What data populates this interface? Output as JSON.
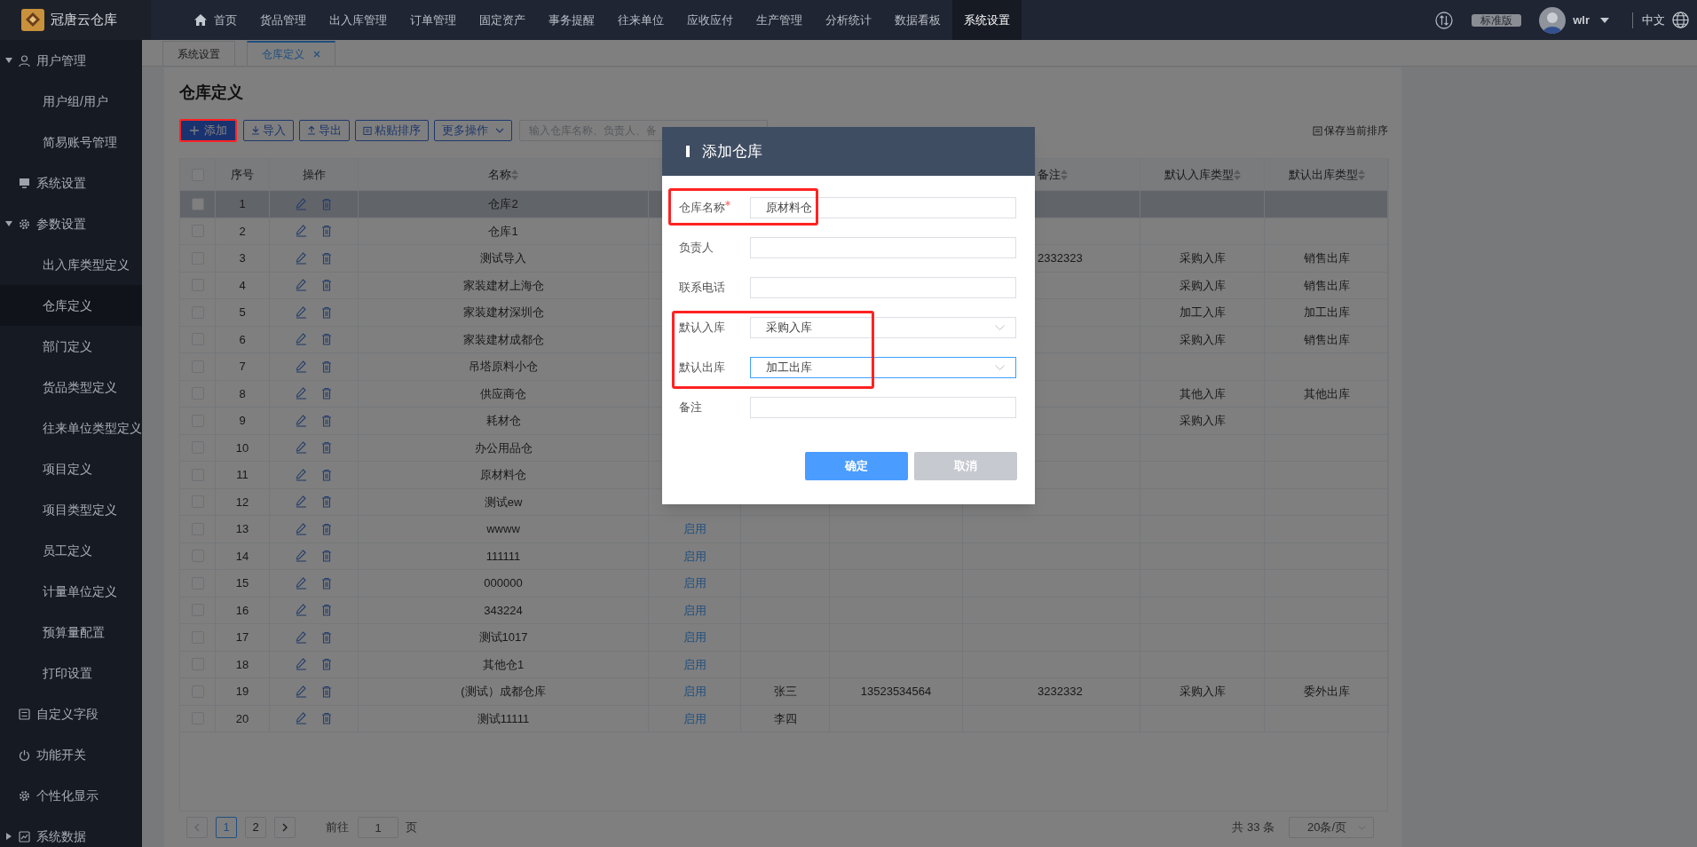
{
  "app": {
    "title": "冠唐云仓库"
  },
  "nav": {
    "items": [
      {
        "label": "首页",
        "selected": false
      },
      {
        "label": "货品管理",
        "selected": false
      },
      {
        "label": "出入库管理",
        "selected": false
      },
      {
        "label": "订单管理",
        "selected": false
      },
      {
        "label": "固定资产",
        "selected": false
      },
      {
        "label": "事务提醒",
        "selected": false
      },
      {
        "label": "往来单位",
        "selected": false
      },
      {
        "label": "应收应付",
        "selected": false
      },
      {
        "label": "生产管理",
        "selected": false
      },
      {
        "label": "分析统计",
        "selected": false
      },
      {
        "label": "数据看板",
        "selected": false
      },
      {
        "label": "系统设置",
        "selected": true
      }
    ]
  },
  "header_right": {
    "edition": "标准版",
    "user": "wlr",
    "language": "中文"
  },
  "sidebar": {
    "items": [
      {
        "label": "用户管理",
        "expanded": true,
        "children": [
          {
            "label": "用户组/用户",
            "selected": false
          },
          {
            "label": "简易账号管理",
            "selected": false
          }
        ]
      },
      {
        "label": "系统设置"
      },
      {
        "label": "参数设置",
        "expanded": true,
        "children": [
          {
            "label": "出入库类型定义",
            "selected": false
          },
          {
            "label": "仓库定义",
            "selected": true
          },
          {
            "label": "部门定义",
            "selected": false
          },
          {
            "label": "货品类型定义",
            "selected": false
          },
          {
            "label": "往来单位类型定义",
            "selected": false
          },
          {
            "label": "项目定义",
            "selected": false
          },
          {
            "label": "项目类型定义",
            "selected": false
          },
          {
            "label": "员工定义",
            "selected": false
          },
          {
            "label": "计量单位定义",
            "selected": false
          },
          {
            "label": "预算量配置",
            "selected": false
          },
          {
            "label": "打印设置",
            "selected": false
          }
        ]
      },
      {
        "label": "自定义字段"
      },
      {
        "label": "功能开关"
      },
      {
        "label": "个性化显示"
      },
      {
        "label": "系统数据",
        "expanded": false
      }
    ]
  },
  "tabs": [
    {
      "label": "系统设置",
      "selected": false,
      "closable": false
    },
    {
      "label": "仓库定义",
      "selected": true,
      "closable": true
    }
  ],
  "page": {
    "title": "仓库定义",
    "toolbar": [
      {
        "label": "添加",
        "kind": "add"
      },
      {
        "label": "导入",
        "kind": "import"
      },
      {
        "label": "导出",
        "kind": "export"
      },
      {
        "label": "粘贴排序",
        "kind": "paste"
      },
      {
        "label": "更多操作",
        "kind": "menu"
      }
    ],
    "search": {
      "placeholder": "输入仓库名称、负责人、备"
    },
    "save_sort": "保存当前排序"
  },
  "table": {
    "header": {
      "checked": false,
      "seq": {
        "text": "序号",
        "sortable": false
      },
      "actions": {
        "text": "操作",
        "sortable": false
      },
      "name": {
        "text": "名称",
        "sortable": true
      },
      "remark": {
        "text": "备注",
        "sortable": true
      },
      "in_type": {
        "text": "默认入库类型",
        "sortable": true
      },
      "out_type": {
        "text": "默认出库类型",
        "sortable": true
      }
    },
    "rows": [
      {
        "selected": true,
        "checked": false,
        "seq": "1",
        "name": "仓库2"
      },
      {
        "selected": false,
        "checked": false,
        "seq": "2",
        "name": "仓库1"
      },
      {
        "selected": false,
        "checked": false,
        "seq": "3",
        "name": "测试导入",
        "remark": "2332323",
        "in_type": "采购入库",
        "out_type": "销售出库"
      },
      {
        "selected": false,
        "checked": false,
        "seq": "4",
        "name": "家装建材上海仓",
        "in_type": "采购入库",
        "out_type": "销售出库"
      },
      {
        "selected": false,
        "checked": false,
        "seq": "5",
        "name": "家装建材深圳仓",
        "in_type": "加工入库",
        "out_type": "加工出库"
      },
      {
        "selected": false,
        "checked": false,
        "seq": "6",
        "name": "家装建材成都仓",
        "in_type": "采购入库",
        "out_type": "销售出库"
      },
      {
        "selected": false,
        "checked": false,
        "seq": "7",
        "name": "吊塔原料小仓"
      },
      {
        "selected": false,
        "checked": false,
        "seq": "8",
        "name": "供应商仓",
        "in_type": "其他入库",
        "out_type": "其他出库"
      },
      {
        "selected": false,
        "checked": false,
        "seq": "9",
        "name": "耗材仓",
        "in_type": "采购入库"
      },
      {
        "selected": false,
        "checked": false,
        "seq": "10",
        "name": "办公用品仓"
      },
      {
        "selected": false,
        "checked": false,
        "seq": "11",
        "name": "原材料仓"
      },
      {
        "selected": false,
        "checked": false,
        "seq": "12",
        "name": "测试ew"
      },
      {
        "selected": false,
        "checked": false,
        "seq": "13",
        "name": "wwww",
        "column_5": "启用"
      },
      {
        "selected": false,
        "checked": false,
        "seq": "14",
        "name": "111111",
        "column_5": "启用"
      },
      {
        "selected": false,
        "checked": false,
        "seq": "15",
        "name": "000000",
        "column_5": "启用"
      },
      {
        "selected": false,
        "checked": false,
        "seq": "16",
        "name": "343224",
        "column_5": "启用"
      },
      {
        "selected": false,
        "checked": false,
        "seq": "17",
        "name": "测试1017",
        "column_5": "启用"
      },
      {
        "selected": false,
        "checked": false,
        "seq": "18",
        "name": "其他仓1",
        "column_5": "启用"
      },
      {
        "selected": false,
        "checked": false,
        "seq": "19",
        "name": "(测试）成都仓库",
        "column_5": "启用",
        "column_6": "张三",
        "column_7": "13523534564",
        "remark": "3232332",
        "in_type": "采购入库",
        "out_type": "委外出库"
      },
      {
        "selected": false,
        "checked": false,
        "seq": "20",
        "name": "测试11111",
        "column_5": "启用",
        "column_6": "李四"
      }
    ]
  },
  "pagination": {
    "pages": [
      {
        "label": "1",
        "selected": true
      },
      {
        "label": "2",
        "selected": false
      }
    ],
    "goto_label": "前往",
    "goto_value": "1",
    "page_unit": "页",
    "total": "共 33 条",
    "page_size": "20条/页"
  },
  "dialog": {
    "title": "添加仓库",
    "fields": [
      {
        "label": "仓库名称",
        "required": true,
        "kind": "text",
        "value": "原材料仓",
        "focused": false
      },
      {
        "label": "负责人",
        "required": false,
        "kind": "text",
        "focused": false
      },
      {
        "label": "联系电话",
        "required": false,
        "kind": "text",
        "focused": false
      },
      {
        "label": "默认入库",
        "required": false,
        "kind": "select",
        "value": "采购入库",
        "focused": false
      },
      {
        "label": "默认出库",
        "required": false,
        "kind": "select",
        "value": "加工出库",
        "focused": true
      },
      {
        "label": "备注",
        "required": false,
        "kind": "text",
        "focused": false
      }
    ],
    "buttons": [
      {
        "label": "确定",
        "kind": "primary"
      },
      {
        "label": "取消",
        "kind": "secondary"
      }
    ]
  }
}
